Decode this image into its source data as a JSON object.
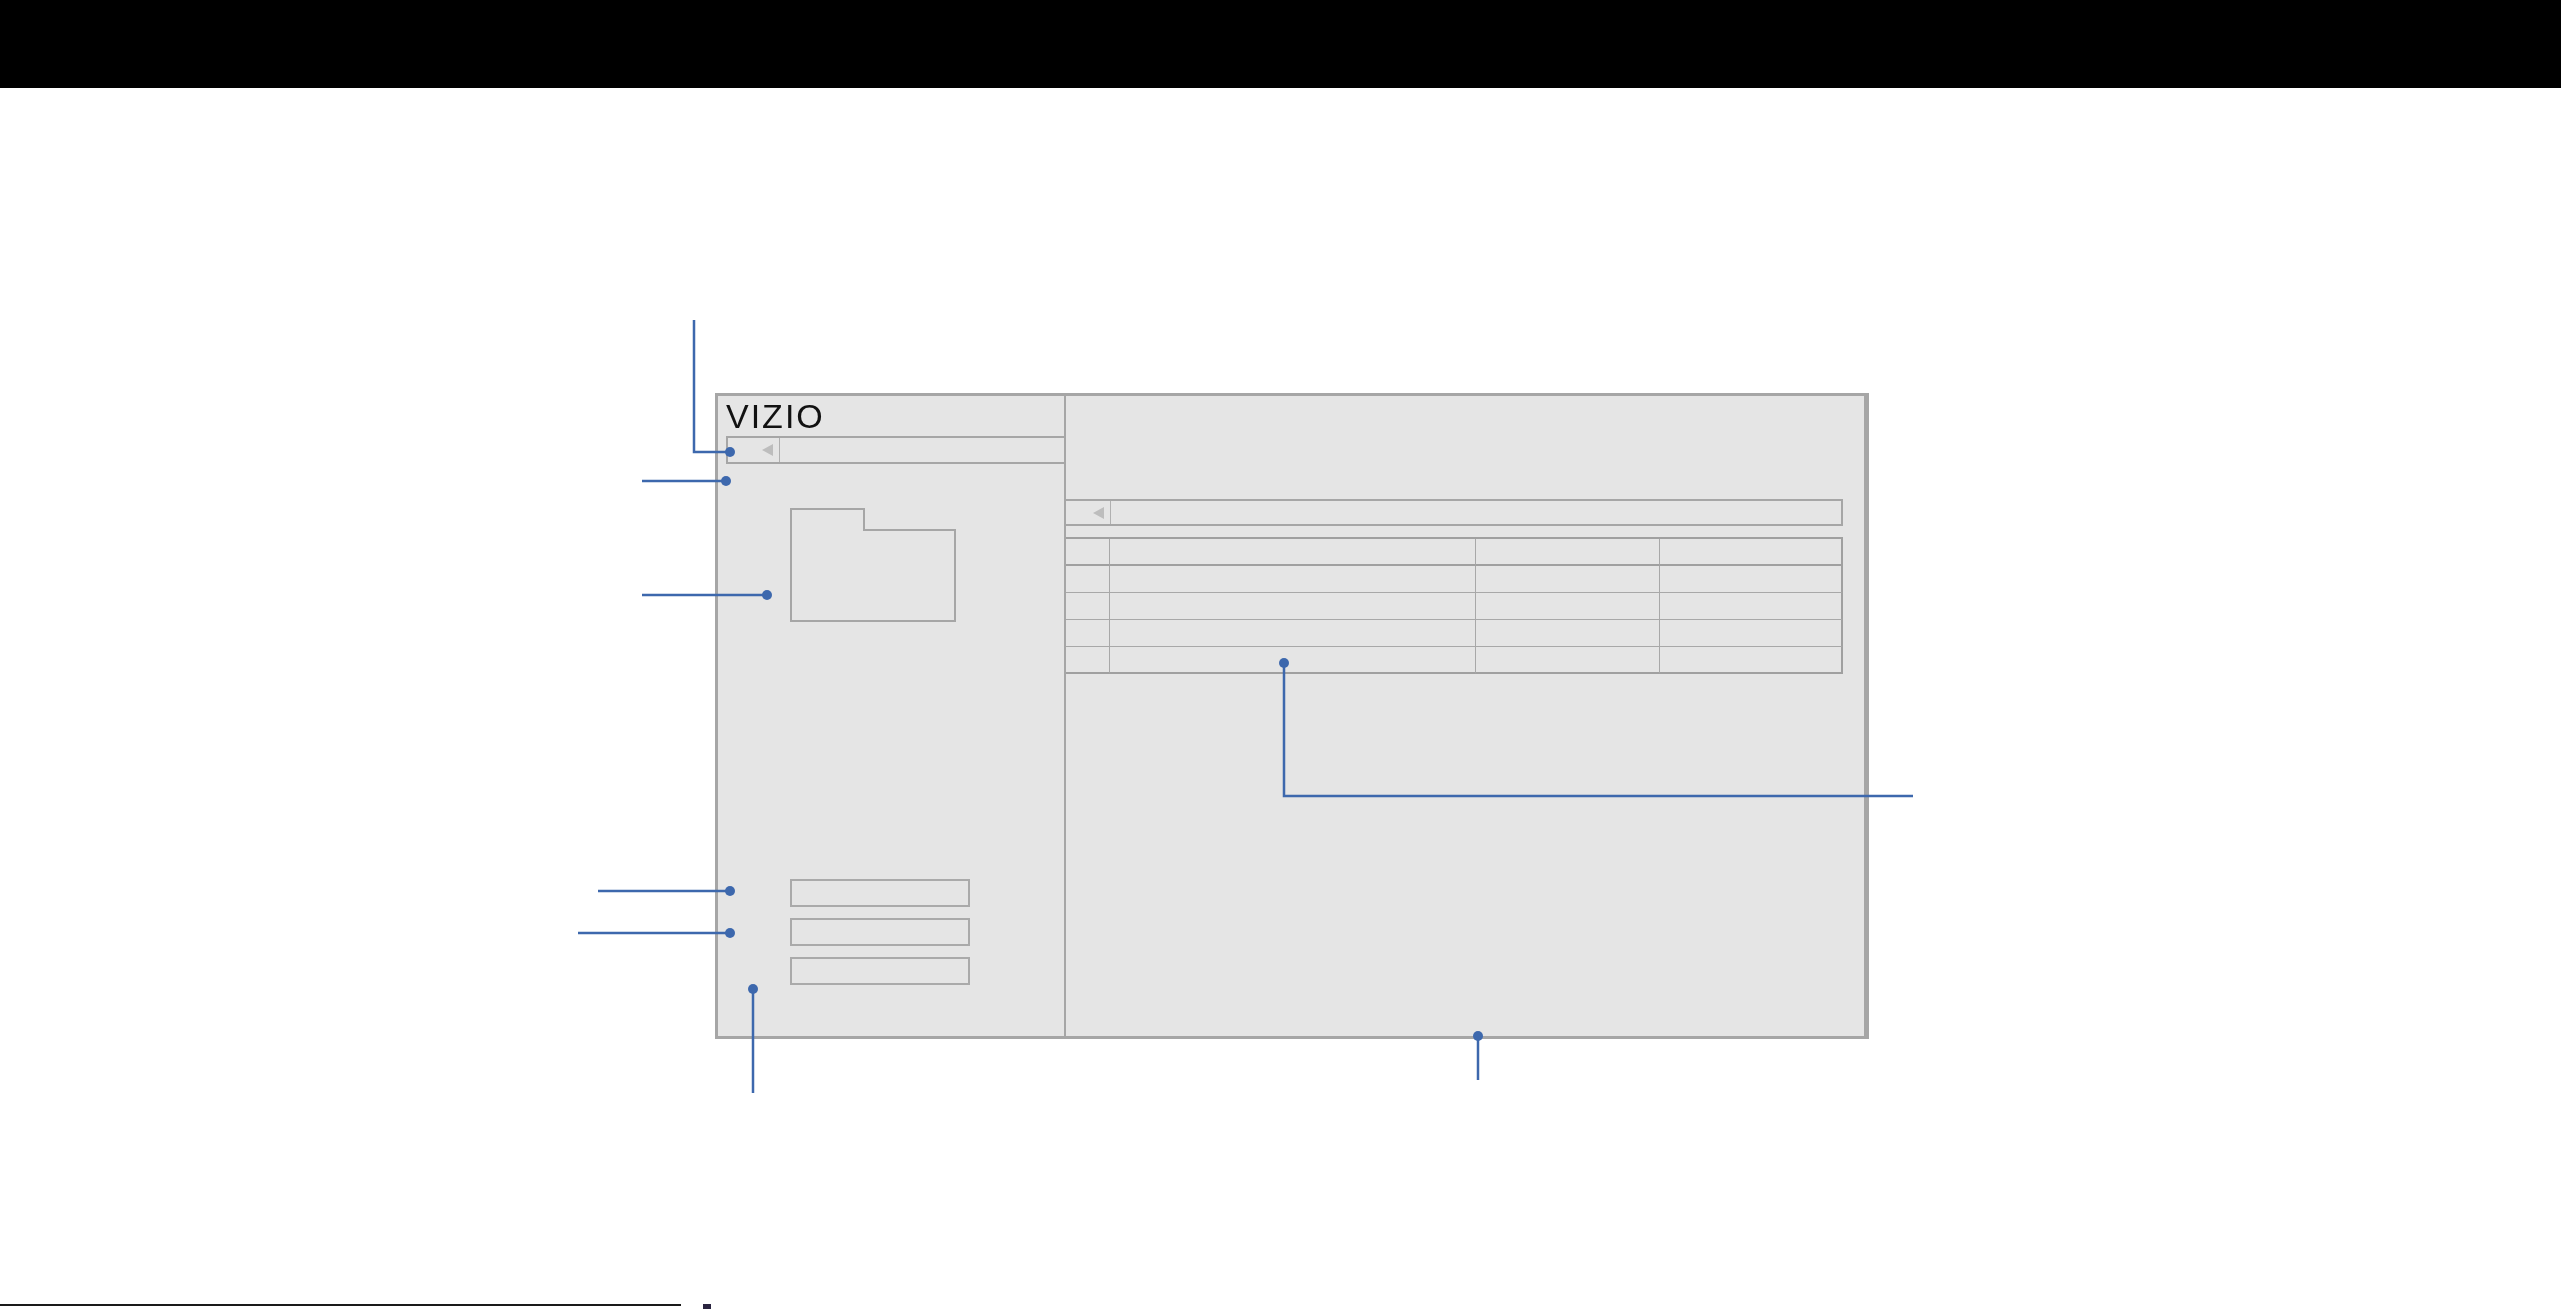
{
  "app_window": {
    "logo": "VIZIO"
  }
}
